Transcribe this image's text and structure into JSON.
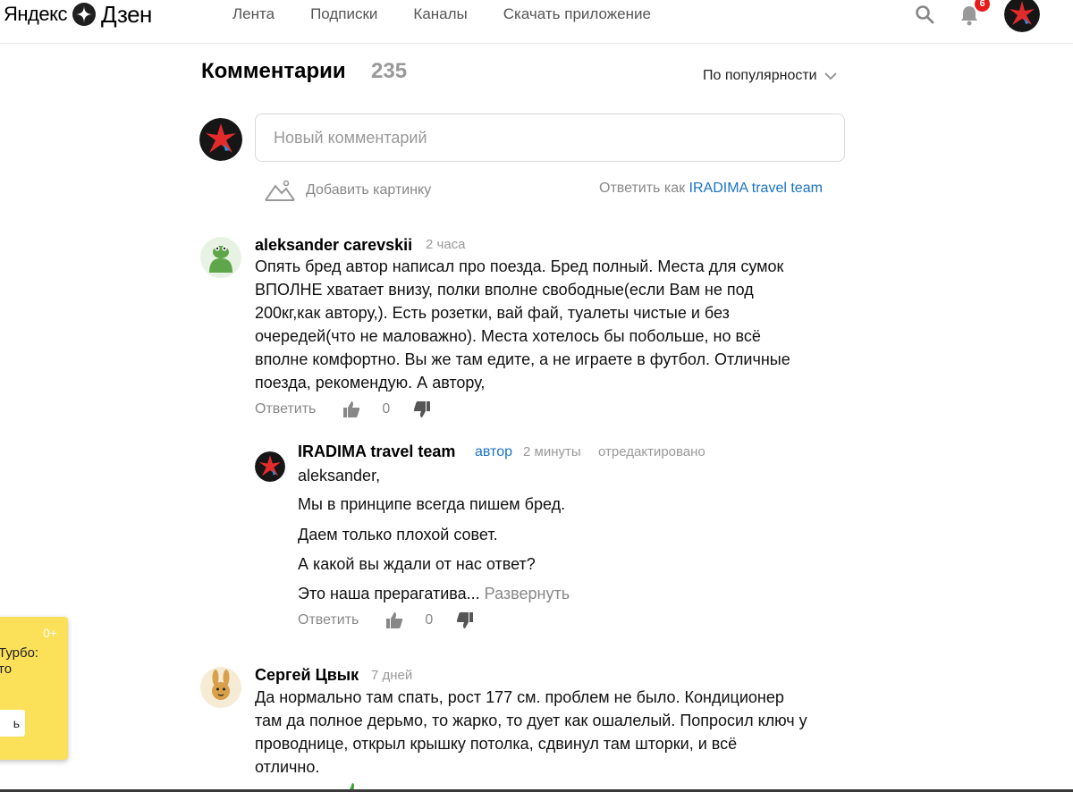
{
  "header": {
    "logo_yandex": "Яндекс",
    "logo_dzen": "Дзен",
    "nav": [
      "Лента",
      "Подписки",
      "Каналы",
      "Скачать приложение"
    ],
    "notification_count": "6"
  },
  "comments": {
    "title": "Комментарии",
    "count": "235",
    "sort_label": "По популярности",
    "new_comment_placeholder": "Новый комментарий",
    "add_picture": "Добавить картинку",
    "reply_as_prefix": "Ответить как",
    "reply_as_name": "IRADIMA travel team"
  },
  "items": [
    {
      "author": "aleksander carevskii",
      "time": "2 часа",
      "lines": [
        "Опять бред автор написал про поезда. Бред полный. Места для сумок",
        "ВПОЛНЕ хватает внизу, полки вполне свободные(если Вам не под",
        "200кг,как автору,). Есть розетки, вай фай, туалеты чистые и без",
        "очередей(что не маловажно). Места хотелось бы побольше, но всё",
        "вполне комфортно. Вы же там едите, а не играете в футбол. Отличные",
        "поезда, рекомендую. А автору,"
      ],
      "reply_label": "Ответить",
      "likes": "0"
    },
    {
      "author": "IRADIMA travel team",
      "badge": "автор",
      "time": "2 минуты",
      "edited": "отредактировано",
      "paragraphs": [
        "aleksander,",
        "Мы в принципе всегда пишем бред.",
        "Даем только плохой совет.",
        "А какой вы ждали от нас ответ?",
        "Это наша прерагатива..."
      ],
      "expand": "Развернуть",
      "reply_label": "Ответить",
      "likes": "0"
    },
    {
      "author": "Сергей Цвык",
      "time": "7 дней",
      "lines": [
        "Да нормально там спать, рост 177 см. проблем не было. Кондиционер",
        "там да полное дерьмо, то жарко, то дует как ошалелый. Попросил ключ у",
        "проводнице, открыл крышку потолка, сдвинул там шторки, и всё",
        "отлично."
      ]
    }
  ],
  "turbo_popup": {
    "age": "0+",
    "line1": "Турбо:",
    "line2": "то",
    "button": "ь"
  },
  "colors": {
    "link_blue": "#1a73c8",
    "badge_red": "#ea1b1b",
    "popup_yellow": "#fbe05a"
  }
}
